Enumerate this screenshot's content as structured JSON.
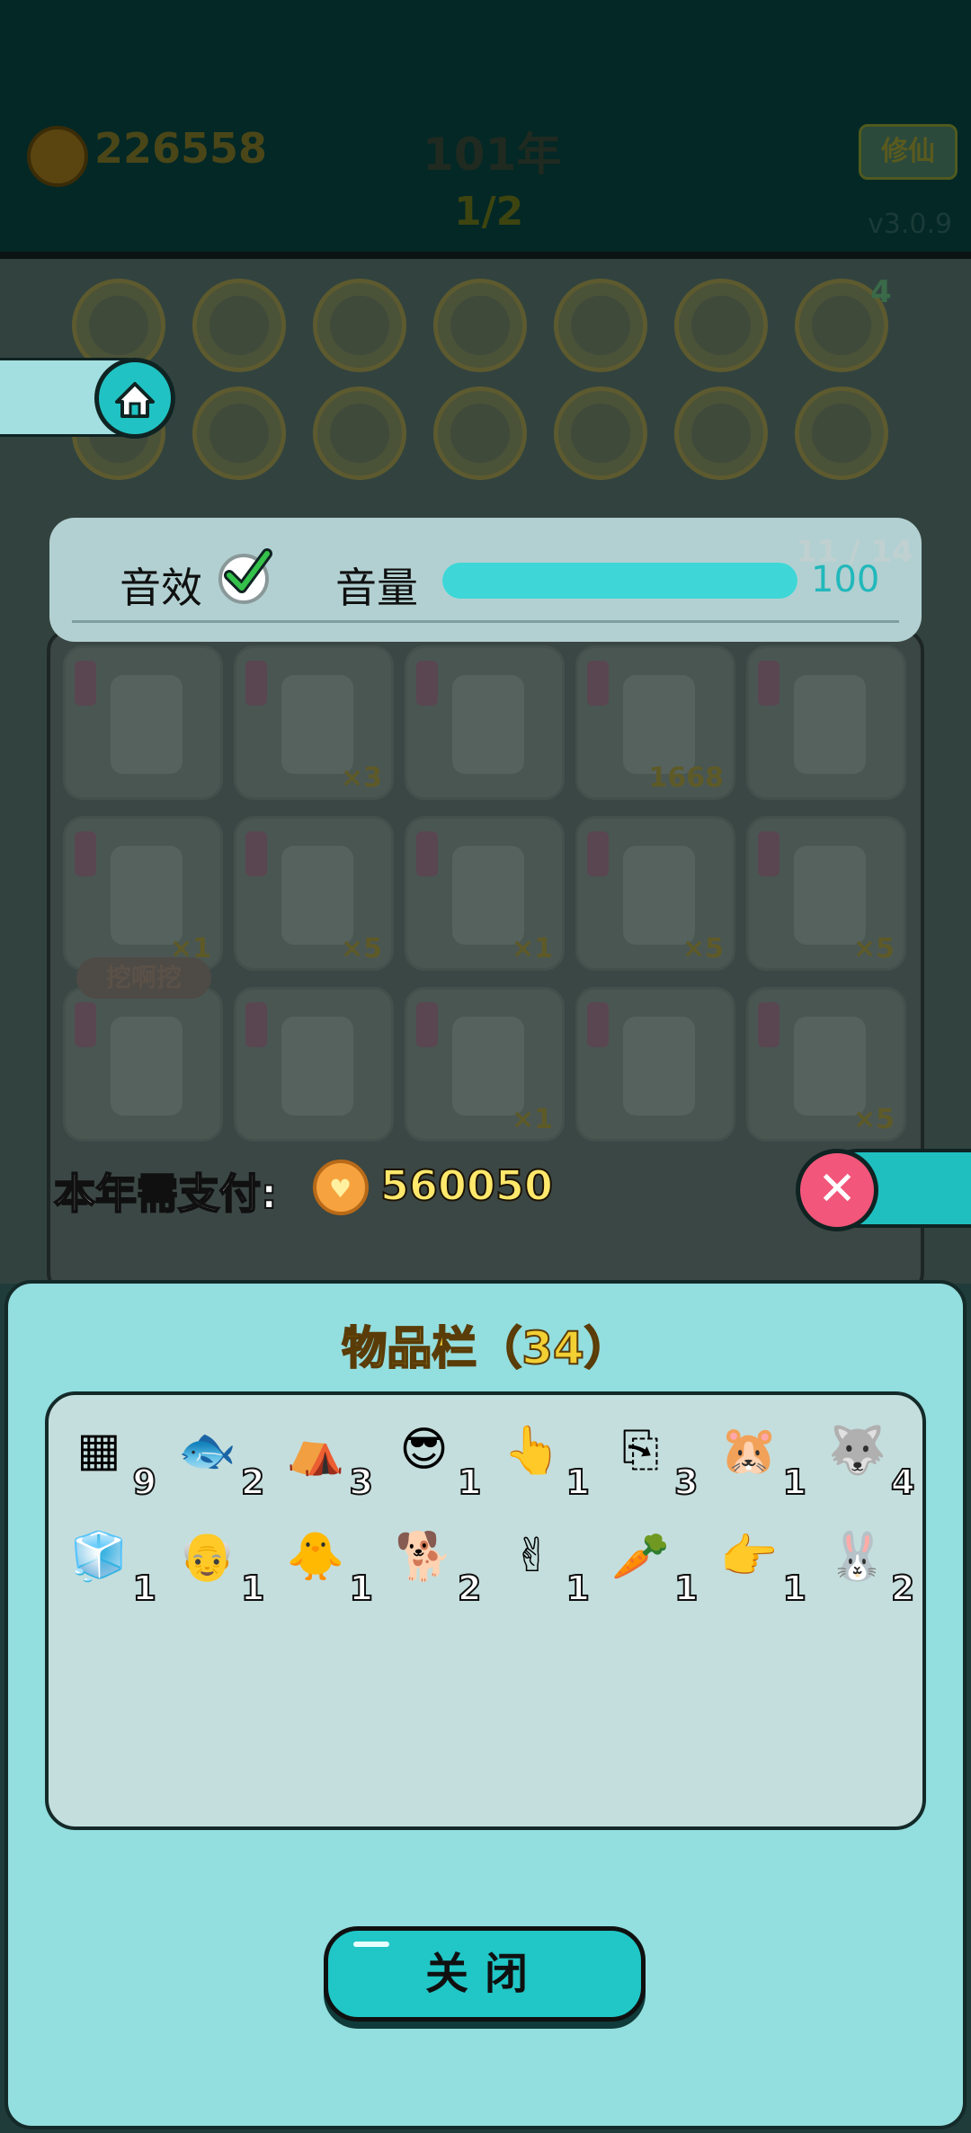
{
  "hud": {
    "coins": "226558",
    "year": "101年",
    "wave": "1/2",
    "mode_button": "修仙",
    "version": "v3.0.9",
    "badge_count": "4"
  },
  "board": {
    "page_indicator": "11 / 14",
    "dig_label": "挖啊挖",
    "card_counts": [
      "",
      "×3",
      "",
      "1668",
      "",
      "×1",
      "×5",
      "×1",
      "×5",
      "×5",
      "",
      "",
      "×1",
      "",
      "×5"
    ]
  },
  "settings": {
    "sfx_label": "音效",
    "sfx_enabled": true,
    "volume_label": "音量",
    "volume_value": "100",
    "volume_level": 1.0
  },
  "payment": {
    "label": "本年需支付:",
    "amount": "560050"
  },
  "inventory": {
    "title": "物品栏（34）",
    "items": [
      {
        "icon": "gpu-card-icon",
        "glyph": "▦",
        "count": "9"
      },
      {
        "icon": "koi-fish-icon",
        "glyph": "🐟",
        "count": "2"
      },
      {
        "icon": "rabbit-tent-icon",
        "glyph": "⛺",
        "count": "3"
      },
      {
        "icon": "green-cap-guy-icon",
        "glyph": "😎",
        "count": "1"
      },
      {
        "icon": "yellow-hand-icon",
        "glyph": "👆",
        "count": "1"
      },
      {
        "icon": "copy-paste-icon",
        "glyph": "⎘",
        "count": "3"
      },
      {
        "icon": "hamster-icon",
        "glyph": "🐹",
        "count": "1"
      },
      {
        "icon": "husky-king-icon",
        "glyph": "🐺",
        "count": "4"
      },
      {
        "icon": "fridge-icon",
        "glyph": "🧊",
        "count": "1"
      },
      {
        "icon": "bald-grandpa-icon",
        "glyph": "👴",
        "count": "1"
      },
      {
        "icon": "chick-face-icon",
        "glyph": "🐥",
        "count": "1"
      },
      {
        "icon": "husky-icon",
        "glyph": "🐕",
        "count": "2"
      },
      {
        "icon": "brown-hand-icon",
        "glyph": "✌",
        "count": "1"
      },
      {
        "icon": "carrot-icon",
        "glyph": "🥕",
        "count": "1"
      },
      {
        "icon": "gray-hand-icon",
        "glyph": "👉",
        "count": "1"
      },
      {
        "icon": "red-rabbit-icon",
        "glyph": "🐰",
        "count": "2"
      }
    ],
    "close_label": "关闭"
  },
  "colors": {
    "accent": "#21c6c6",
    "sheet": "#93dedf",
    "inventory_box": "#c4dedd",
    "title": "#f2cf33",
    "pay_value": "#ffe86b",
    "close_x": "#f2567a"
  }
}
